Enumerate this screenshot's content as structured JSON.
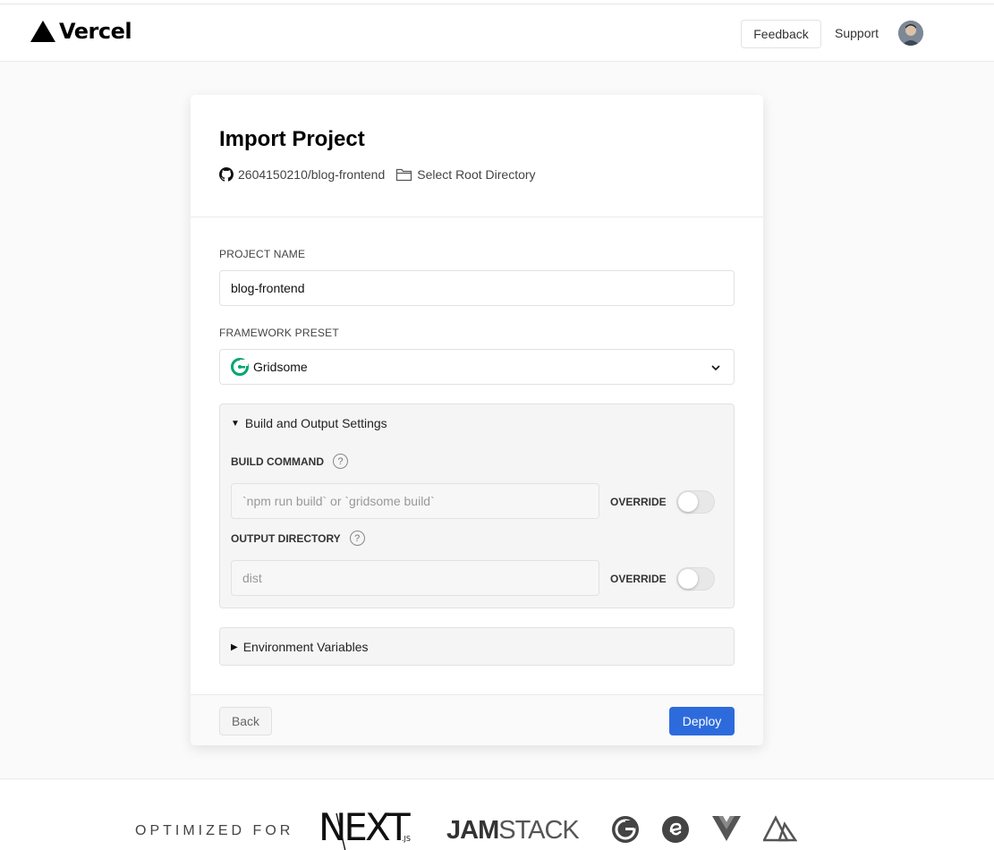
{
  "header": {
    "brand": "Vercel",
    "feedback_label": "Feedback",
    "support_label": "Support"
  },
  "card": {
    "title": "Import Project",
    "repo": "2604150210/blog-frontend",
    "root_dir_label": "Select Root Directory",
    "project_name": {
      "label": "PROJECT NAME",
      "value": "blog-frontend"
    },
    "framework": {
      "label": "FRAMEWORK PRESET",
      "selected": "Gridsome"
    },
    "build_settings": {
      "title": "Build and Output Settings",
      "build_command": {
        "label": "BUILD COMMAND",
        "placeholder": "`npm run build` or `gridsome build`",
        "override_label": "OVERRIDE"
      },
      "output_directory": {
        "label": "OUTPUT DIRECTORY",
        "placeholder": "dist",
        "override_label": "OVERRIDE"
      }
    },
    "env_vars": {
      "title": "Environment Variables"
    },
    "back_label": "Back",
    "deploy_label": "Deploy"
  },
  "footer": {
    "optimized_label": "OPTIMIZED FOR",
    "next_label": "NEXT",
    "next_suffix": ".JS",
    "jam_bold": "JAM",
    "jam_light": "STACK"
  },
  "colors": {
    "deploy": "#2d6bdd",
    "gridsome": "#00a672"
  }
}
